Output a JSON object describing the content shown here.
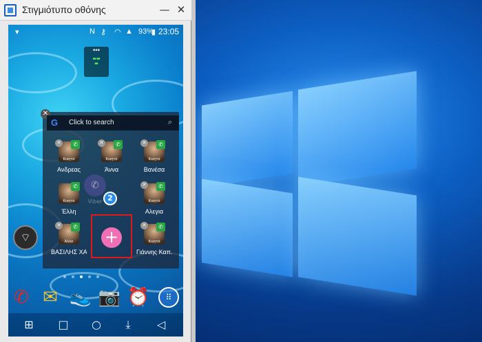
{
  "window": {
    "title": "Στιγμιότυπο οθόνης",
    "minimize": "—",
    "close": "✕"
  },
  "statusbar": {
    "battery": "93%",
    "time": "23:05",
    "icons": [
      "wifi-icon",
      "nfc-icon",
      "key-icon",
      "signal-icon",
      "battery-icon"
    ]
  },
  "search": {
    "placeholder": "Click to search",
    "logo": "G",
    "icon": "🔍"
  },
  "folder": {
    "contacts": [
      {
        "name": "Ανδρεας",
        "caption": "Κινητό"
      },
      {
        "name": "Άννα",
        "caption": "Κινητό"
      },
      {
        "name": "Βανέσα",
        "caption": "Κινητό"
      },
      {
        "name": "Έλλη",
        "caption": "Κινητό"
      },
      {
        "name": "Αλεγια",
        "caption": "Κινητό"
      },
      {
        "name": "ΒΑΣΙΛΗΣ ΧΑ...",
        "caption": "Άλλο"
      },
      {
        "name": "Γιάννης Καπ...",
        "caption": "Κινητό"
      }
    ],
    "ghost_app": "Viber",
    "count_badge": "2",
    "add_symbol": "+"
  },
  "colors": {
    "accent_add": "#f06fb5",
    "highlight": "#e01818",
    "badge": "#2a8ee8",
    "call_green": "#27a644"
  },
  "dock": {
    "apps": [
      "phone-app-icon",
      "email-app-icon",
      "sneakers-app-icon",
      "camera-app-icon",
      "alarm-app-icon",
      "app-drawer-icon"
    ]
  },
  "navbar": {
    "keys": [
      "recents-key",
      "home-key",
      "search-key",
      "download-key",
      "back-key"
    ]
  }
}
